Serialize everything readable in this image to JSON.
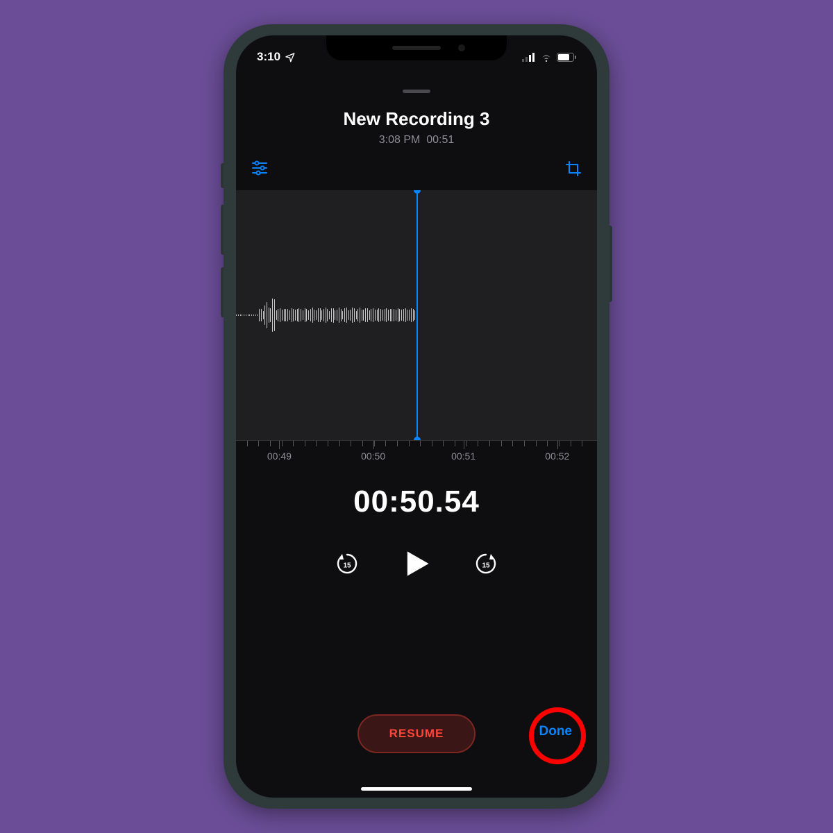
{
  "statusbar": {
    "time": "3:10"
  },
  "recording": {
    "title": "New Recording 3",
    "created_time": "3:08 PM",
    "duration": "00:51"
  },
  "timeline": {
    "labels": [
      "00:49",
      "00:50",
      "00:51",
      "00:52"
    ]
  },
  "playback": {
    "current_time": "00:50.54",
    "skip_back_seconds": "15",
    "skip_forward_seconds": "15"
  },
  "buttons": {
    "resume": "RESUME",
    "done": "Done"
  },
  "colors": {
    "accent_blue": "#0a84ff",
    "accent_red": "#ff453a",
    "background": "#0e0e10",
    "page_bg": "#6a4d96"
  }
}
